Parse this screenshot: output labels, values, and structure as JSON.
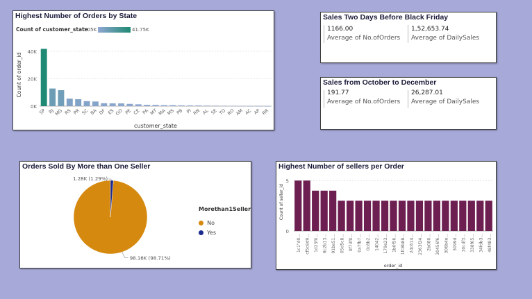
{
  "colors": {
    "background": "#a7a9d9",
    "bar_grad_low": "#8fa6d2",
    "bar_grad_high": "#1e8a73",
    "pie_no": "#d6890f",
    "pie_yes": "#1b2a8c",
    "sellers_bar": "#6e1f51"
  },
  "state_chart": {
    "title": "Highest Number of Orders by State",
    "legend_label": "Count of customer_state",
    "legend_min": "0.05K",
    "legend_max": "41.75K",
    "ylabel": "Count of order_id",
    "xlabel": "customer_state",
    "ytick_labels": [
      "0K",
      "20K",
      "40K"
    ],
    "chart_data": {
      "type": "bar",
      "categories": [
        "SP",
        "RJ",
        "MG",
        "RS",
        "PR",
        "SC",
        "BA",
        "DF",
        "ES",
        "GO",
        "PE",
        "CE",
        "PA",
        "MT",
        "MA",
        "MS",
        "PB",
        "PI",
        "RN",
        "AL",
        "SE",
        "TO",
        "RO",
        "AM",
        "AC",
        "AP",
        "RR"
      ],
      "values": [
        41750,
        12850,
        11630,
        5470,
        5050,
        3640,
        3380,
        2140,
        2030,
        2020,
        1650,
        1340,
        980,
        910,
        750,
        720,
        540,
        500,
        490,
        410,
        350,
        280,
        250,
        150,
        80,
        70,
        50
      ],
      "ylim": [
        0,
        45000
      ]
    }
  },
  "card_black_friday": {
    "title": "Sales Two Days Before Black Friday",
    "value1": "1166.00",
    "label1": "Average of No.ofOrders",
    "value2": "1,52,653.74",
    "label2": "Average of DailySales"
  },
  "card_oct_dec": {
    "title": "Sales from October to December",
    "value1": "191.77",
    "label1": "Average of No.ofOrders",
    "value2": "26,287.01",
    "label2": "Average of DailySales"
  },
  "pie_chart": {
    "title": "Orders Sold By More than One Seller",
    "legend_title": "Morethan1Seller",
    "chart_data": {
      "type": "pie",
      "slices": [
        {
          "label": "No",
          "value": 98160,
          "display": "98.16K (98.71%)"
        },
        {
          "label": "Yes",
          "value": 1280,
          "display": "1.28K (1.29%)"
        }
      ]
    }
  },
  "sellers_chart": {
    "title": "Highest Number of sellers per Order",
    "ylabel": "Count of seller_id",
    "xlabel": "order_id",
    "ytick_labels": [
      "0",
      "5"
    ],
    "chart_data": {
      "type": "bar",
      "categories": [
        "1c1\"d0...",
        "cf5c8d9...",
        "1d23f0...",
        "8c2b13...",
        "91be51...",
        "05d5c8...",
        "0f73f0...",
        "0a7fb7...",
        "0c8b2...",
        "14042...",
        "179e23...",
        "1b0f56...",
        "1fc8b88...",
        "24c614...",
        "2363f24...",
        "2b080...",
        "30456f6...",
        "306b4e...",
        "3099d...",
        "30cdf3...",
        "338f65...",
        "34fdb3...",
        "48f483..."
      ],
      "values": [
        5,
        5,
        4,
        4,
        4,
        3,
        3,
        3,
        3,
        3,
        3,
        3,
        3,
        3,
        3,
        3,
        3,
        3,
        3,
        3,
        3,
        3,
        3
      ],
      "ylim": [
        0,
        5.5
      ]
    }
  }
}
